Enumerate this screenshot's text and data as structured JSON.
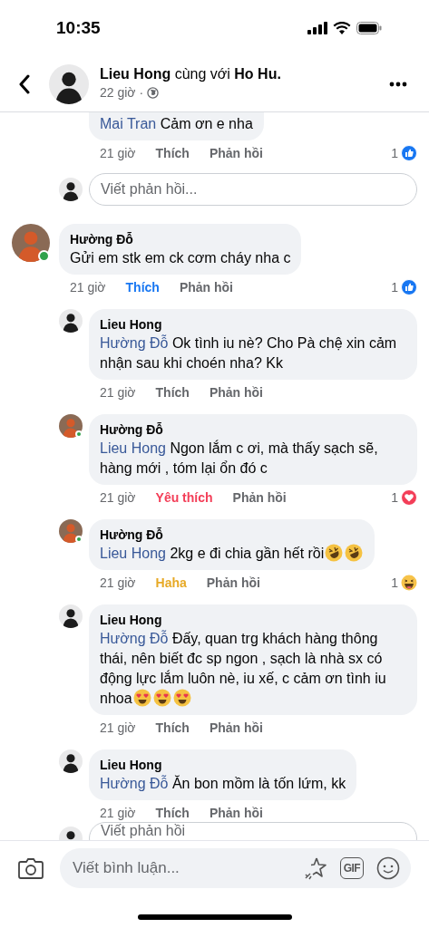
{
  "status_bar": {
    "time": "10:35"
  },
  "header": {
    "author": "Lieu Hong",
    "connector": "cùng với",
    "tagged": "Ho Hu.",
    "time": "22 giờ ·",
    "avatar": {
      "kind": "light"
    }
  },
  "threads": [
    {
      "replies": [
        {
          "partial": true,
          "mention": "Mai Tran",
          "text": "Cảm ơn e nha",
          "time": "21 giờ",
          "like_label": "Thích",
          "reply_label": "Phản hồi",
          "summary": {
            "count": "1",
            "kind": "like"
          }
        }
      ],
      "reply_field": {
        "placeholder": "Viết phản hồi...",
        "avatar": {
          "kind": "light"
        }
      }
    },
    {
      "author": "Hường Đỗ",
      "avatar": {
        "kind": "warm"
      },
      "online": true,
      "text": "Gửi em stk em ck cơm cháy nha c",
      "time": "21 giờ",
      "like_label": "Thích",
      "reaction": {
        "kind": "like"
      },
      "reply_label": "Phản hồi",
      "summary": {
        "count": "1",
        "kind": "like"
      },
      "replies": [
        {
          "author": "Lieu Hong",
          "avatar": {
            "kind": "light"
          },
          "online": false,
          "mention": "Hường Đỗ",
          "text": "Ok tình iu nè? Cho Pà chệ xin cảm nhận sau khi choén nha? Kk",
          "time": "21 giờ",
          "like_label": "Thích",
          "reply_label": "Phản hồi"
        },
        {
          "author": "Hường Đỗ",
          "avatar": {
            "kind": "warm"
          },
          "online": true,
          "mention": "Lieu Hong",
          "text": "Ngon lắm c ơi, mà thấy sạch sẽ, hàng mới , tóm lại ổn đó c",
          "time": "21 giờ",
          "like_label": "Yêu thích",
          "reaction": {
            "kind": "love"
          },
          "reply_label": "Phản hồi",
          "summary": {
            "count": "1",
            "kind": "love"
          }
        },
        {
          "author": "Hường Đỗ",
          "avatar": {
            "kind": "warm"
          },
          "online": true,
          "mention": "Lieu Hong",
          "text": "2kg e đi chia gần hết rồi",
          "emoji": [
            {
              "kind": "rofl"
            },
            {
              "kind": "rofl"
            }
          ],
          "time": "21 giờ",
          "like_label": "Haha",
          "reaction": {
            "kind": "haha"
          },
          "reply_label": "Phản hồi",
          "summary": {
            "count": "1",
            "kind": "haha"
          }
        },
        {
          "author": "Lieu Hong",
          "avatar": {
            "kind": "light"
          },
          "online": false,
          "mention": "Hường Đỗ",
          "text": "Đấy, quan trg khách hàng thông thái, nên biết đc sp ngon , sạch là nhà sx có động lực lắm luôn nè, iu xế, c cảm ơn tình iu nhoa",
          "emoji": [
            {
              "kind": "heart-eyes"
            },
            {
              "kind": "heart-eyes"
            },
            {
              "kind": "heart-eyes"
            }
          ],
          "time": "21 giờ",
          "like_label": "Thích",
          "reply_label": "Phản hồi"
        },
        {
          "author": "Lieu Hong",
          "avatar": {
            "kind": "light"
          },
          "online": false,
          "mention": "Hường Đỗ",
          "text": "Ăn bon mồm là tốn lứm, kk",
          "time": "21 giờ",
          "like_label": "Thích",
          "reply_label": "Phản hồi"
        }
      ],
      "reply_field": {
        "placeholder": "Viết phản hồi",
        "avatar": {
          "kind": "light"
        }
      }
    }
  ],
  "composer": {
    "placeholder": "Viết bình luận...",
    "gif_label": "GIF"
  }
}
